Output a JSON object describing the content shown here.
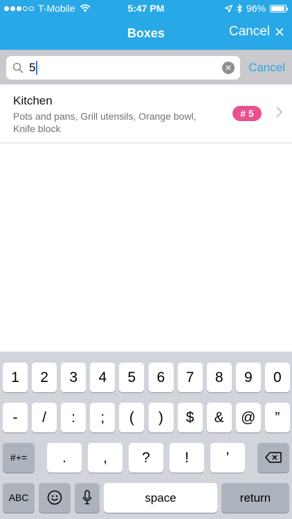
{
  "status_bar": {
    "carrier": "T-Mobile",
    "time": "5:47 PM",
    "battery_percent": "96%",
    "battery_level": 0.96,
    "signal_bars": 3
  },
  "nav": {
    "title": "Boxes",
    "cancel_label": "Cancel"
  },
  "search": {
    "value": "5",
    "cancel_label": "Cancel"
  },
  "results": [
    {
      "title": "Kitchen",
      "description": "Pots and pans, Grill utensils, Orange bowl, Knife block",
      "badge": "# 5"
    }
  ],
  "keyboard": {
    "row1": [
      "1",
      "2",
      "3",
      "4",
      "5",
      "6",
      "7",
      "8",
      "9",
      "0"
    ],
    "row2": [
      "-",
      "/",
      ":",
      ";",
      "(",
      ")",
      "$",
      "&",
      "@",
      "”"
    ],
    "row3": [
      "#+=",
      ".",
      ",",
      "?",
      "!",
      "’"
    ],
    "row4": [
      "ABC",
      "space",
      "return"
    ]
  },
  "colors": {
    "accent": "#29a8e8",
    "badge": "#e8518d"
  }
}
